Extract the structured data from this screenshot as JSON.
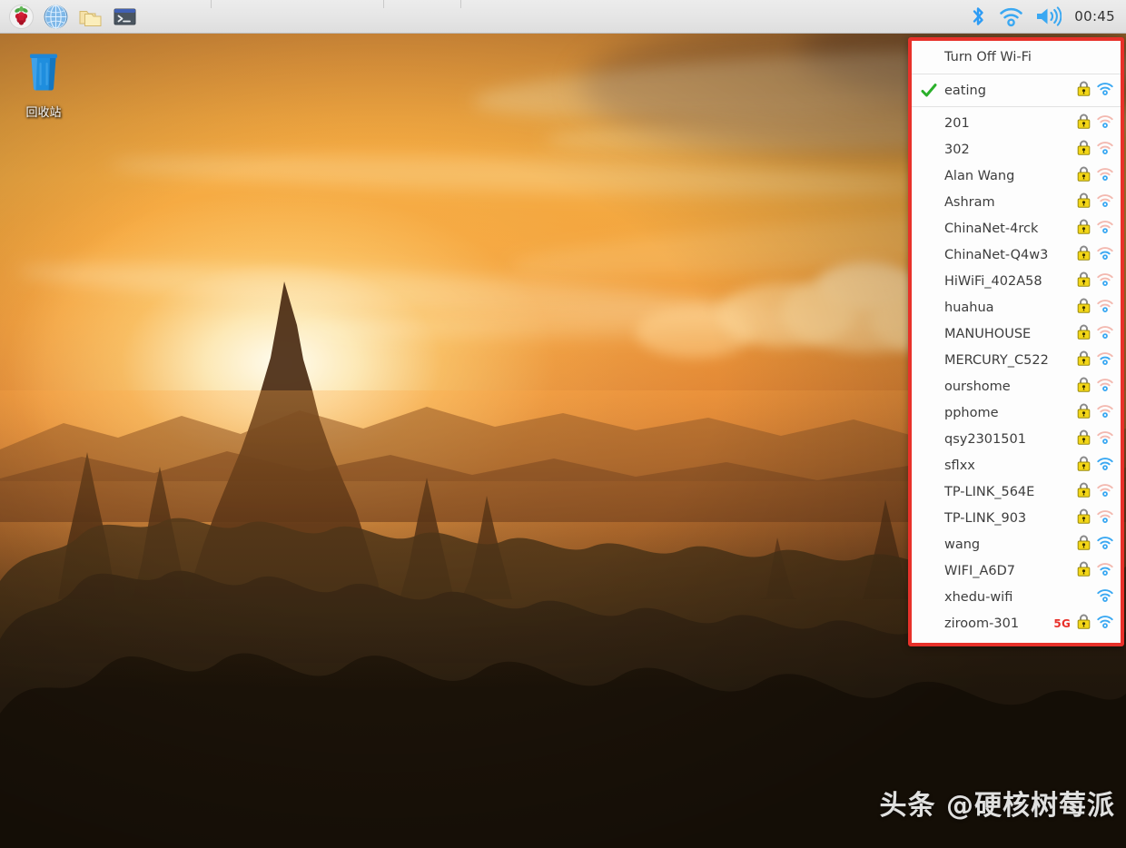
{
  "taskbar": {
    "launchers": [
      {
        "name": "raspberry-menu-icon",
        "title": "Menu"
      },
      {
        "name": "web-browser-icon",
        "title": "Web Browser"
      },
      {
        "name": "file-manager-icon",
        "title": "File Manager"
      },
      {
        "name": "terminal-icon",
        "title": "Terminal"
      }
    ],
    "tray": [
      {
        "name": "bluetooth-icon",
        "title": "Bluetooth"
      },
      {
        "name": "wifi-icon",
        "title": "Wireless & Wired Network"
      },
      {
        "name": "volume-icon",
        "title": "Volume"
      }
    ],
    "clock": "00:45"
  },
  "desktop": {
    "icons": [
      {
        "name": "recycle-bin-icon",
        "label": "回收站"
      }
    ]
  },
  "wifi_menu": {
    "toggle_label": "Turn Off Wi-Fi",
    "connected": {
      "ssid": "eating",
      "secured": true,
      "signal": 3,
      "band": "",
      "checked": true
    },
    "networks": [
      {
        "ssid": "201",
        "secured": true,
        "signal": 1,
        "band": ""
      },
      {
        "ssid": "302",
        "secured": true,
        "signal": 1,
        "band": ""
      },
      {
        "ssid": "Alan Wang",
        "secured": true,
        "signal": 1,
        "band": ""
      },
      {
        "ssid": "Ashram",
        "secured": true,
        "signal": 1,
        "band": ""
      },
      {
        "ssid": "ChinaNet-4rck",
        "secured": true,
        "signal": 1,
        "band": ""
      },
      {
        "ssid": "ChinaNet-Q4w3",
        "secured": true,
        "signal": 2,
        "band": ""
      },
      {
        "ssid": "HiWiFi_402A58",
        "secured": true,
        "signal": 1,
        "band": ""
      },
      {
        "ssid": "huahua",
        "secured": true,
        "signal": 1,
        "band": ""
      },
      {
        "ssid": "MANUHOUSE",
        "secured": true,
        "signal": 1,
        "band": ""
      },
      {
        "ssid": "MERCURY_C522",
        "secured": true,
        "signal": 2,
        "band": ""
      },
      {
        "ssid": "ourshome",
        "secured": true,
        "signal": 1,
        "band": ""
      },
      {
        "ssid": "pphome",
        "secured": true,
        "signal": 1,
        "band": ""
      },
      {
        "ssid": "qsy2301501",
        "secured": true,
        "signal": 1,
        "band": ""
      },
      {
        "ssid": "sflxx",
        "secured": true,
        "signal": 3,
        "band": ""
      },
      {
        "ssid": "TP-LINK_564E",
        "secured": true,
        "signal": 1,
        "band": ""
      },
      {
        "ssid": "TP-LINK_903",
        "secured": true,
        "signal": 1,
        "band": ""
      },
      {
        "ssid": "wang",
        "secured": true,
        "signal": 3,
        "band": ""
      },
      {
        "ssid": "WIFI_A6D7",
        "secured": true,
        "signal": 2,
        "band": ""
      },
      {
        "ssid": "xhedu-wifi",
        "secured": false,
        "signal": 3,
        "band": ""
      },
      {
        "ssid": "ziroom-301",
        "secured": true,
        "signal": 3,
        "band": "5G"
      }
    ]
  },
  "watermark": {
    "text": "头条 @硬核树莓派"
  },
  "colors": {
    "highlight_border": "#e8312a",
    "accent_tray": "#35a2f0",
    "check_green": "#2bb02b",
    "lock_yellow": "#f3d617",
    "band_5g": "#e8312a",
    "menu_bg": "#fdfdfd",
    "taskbar_bg": "#e6e6e6"
  }
}
